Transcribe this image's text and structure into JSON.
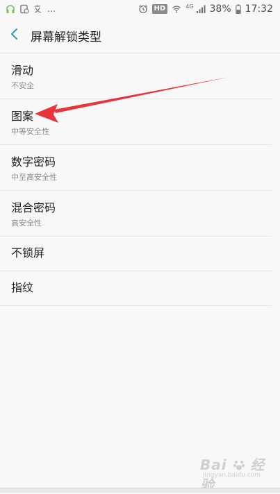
{
  "status_bar": {
    "notifications_more": "...",
    "hd_badge": "HD",
    "network": "4G",
    "battery": "38%",
    "time": "17:32",
    "icons": [
      "headset-icon",
      "screenshot-icon",
      "translate-icon",
      "alarm-icon",
      "wifi-icon",
      "signal-icon",
      "battery-icon"
    ]
  },
  "header": {
    "back_icon": "chevron-left-icon",
    "title": "屏幕解锁类型",
    "accent_color": "#2b9bb8"
  },
  "menu": {
    "items": [
      {
        "title": "滑动",
        "subtitle": "不安全"
      },
      {
        "title": "图案",
        "subtitle": "中等安全性"
      },
      {
        "title": "数字密码",
        "subtitle": "中至高安全性"
      },
      {
        "title": "混合密码",
        "subtitle": "高安全性"
      },
      {
        "title": "不锁屏",
        "subtitle": ""
      },
      {
        "title": "指纹",
        "subtitle": ""
      }
    ]
  },
  "annotation": {
    "arrow_color": "#e8343a",
    "arrow_icon": "red-arrow-annotation"
  },
  "watermark": {
    "text": "Bai",
    "icon": "baidu-paw-icon",
    "text2": "经验",
    "sub": "jingyan.baidu.com"
  }
}
